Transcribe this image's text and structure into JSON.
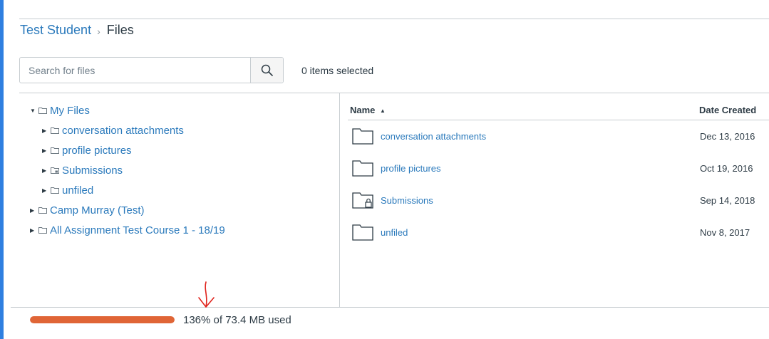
{
  "breadcrumb": {
    "parent": "Test Student",
    "separator": "›",
    "current": "Files"
  },
  "search": {
    "placeholder": "Search for files",
    "value": "",
    "icon": "search-icon"
  },
  "selection": {
    "count_text": "0 items selected"
  },
  "tree": [
    {
      "label": "My Files",
      "expanded": true,
      "icon": "folder-icon"
    },
    {
      "label": "conversation attachments",
      "expanded": false,
      "icon": "folder-icon"
    },
    {
      "label": "profile pictures",
      "expanded": false,
      "icon": "folder-icon"
    },
    {
      "label": "Submissions",
      "expanded": false,
      "icon": "locked-folder-icon"
    },
    {
      "label": "unfiled",
      "expanded": false,
      "icon": "folder-icon"
    },
    {
      "label": "Camp Murray (Test)",
      "expanded": false,
      "icon": "folder-icon"
    },
    {
      "label": "All Assignment Test Course 1 - 18/19",
      "expanded": false,
      "icon": "folder-icon"
    }
  ],
  "table": {
    "columns": {
      "name": "Name",
      "date_created": "Date Created"
    },
    "sort_indicator": "▲",
    "rows": [
      {
        "name": "conversation attachments",
        "date": "Dec 13, 2016",
        "icon": "folder-icon"
      },
      {
        "name": "profile pictures",
        "date": "Oct 19, 2016",
        "icon": "folder-icon"
      },
      {
        "name": "Submissions",
        "date": "Sep 14, 2018",
        "icon": "locked-folder-icon"
      },
      {
        "name": "unfiled",
        "date": "Nov 8, 2017",
        "icon": "folder-icon"
      }
    ]
  },
  "quota": {
    "text": "136% of 73.4 MB used",
    "percent_used": 136
  },
  "colors": {
    "link": "#2b7abc",
    "text": "#2d3b45",
    "quota_fill": "#e06536",
    "annotation": "#e0231c",
    "border": "#c7cdd1"
  }
}
